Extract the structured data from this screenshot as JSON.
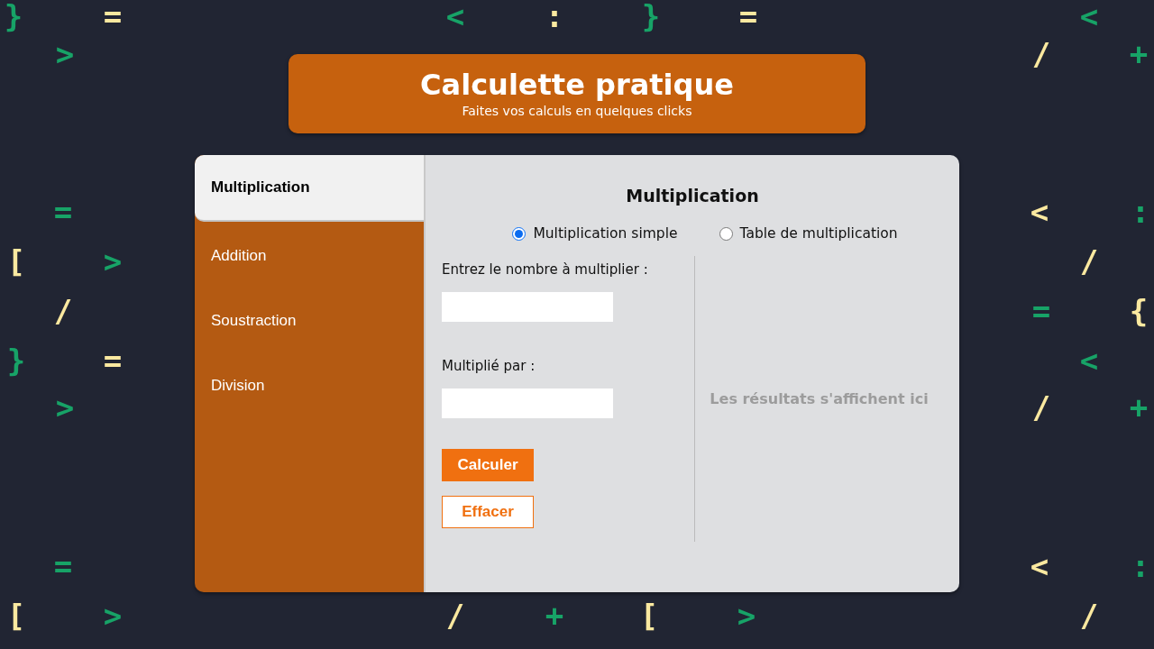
{
  "background_symbols": [
    [
      {
        "char": "}",
        "color": "#17a367"
      },
      {
        "char": "=",
        "color": "#fbe9a0"
      },
      {
        "char": "<",
        "color": "#17a367"
      },
      {
        "char": ":",
        "color": "#fbe9a0"
      },
      {
        "char": "}",
        "color": "#17a367"
      },
      {
        "char": "=",
        "color": "#fbe9a0"
      },
      {
        "char": "<",
        "color": "#17a367"
      }
    ],
    [
      {
        "char": ">",
        "color": "#17a367"
      },
      {
        "char": "/",
        "color": "#fbe9a0"
      },
      {
        "char": "+",
        "color": "#17a367"
      }
    ],
    [
      {
        "char": "=",
        "color": "#17a367"
      },
      {
        "char": "<",
        "color": "#fbe9a0"
      },
      {
        "char": ":",
        "color": "#17a367"
      }
    ],
    [
      {
        "char": "[",
        "color": "#fbe9a0"
      },
      {
        "char": ">",
        "color": "#17a367"
      },
      {
        "char": "/",
        "color": "#fbe9a0"
      }
    ],
    [
      {
        "char": "/",
        "color": "#fbe9a0"
      },
      {
        "char": "=",
        "color": "#17a367"
      },
      {
        "char": "{",
        "color": "#fbe9a0"
      }
    ],
    [
      {
        "char": "}",
        "color": "#17a367"
      },
      {
        "char": "=",
        "color": "#fbe9a0"
      },
      {
        "char": "<",
        "color": "#17a367"
      }
    ],
    [
      {
        "char": ">",
        "color": "#17a367"
      },
      {
        "char": "/",
        "color": "#fbe9a0"
      },
      {
        "char": "+",
        "color": "#17a367"
      }
    ],
    [
      {
        "char": "=",
        "color": "#17a367"
      },
      {
        "char": "<",
        "color": "#fbe9a0"
      },
      {
        "char": ":",
        "color": "#17a367"
      }
    ],
    [
      {
        "char": "[",
        "color": "#fbe9a0"
      },
      {
        "char": ">",
        "color": "#17a367"
      },
      {
        "char": "/",
        "color": "#fbe9a0"
      },
      {
        "char": "+",
        "color": "#17a367"
      },
      {
        "char": "[",
        "color": "#fbe9a0"
      },
      {
        "char": ">",
        "color": "#17a367"
      },
      {
        "char": "/",
        "color": "#fbe9a0"
      }
    ]
  ],
  "header": {
    "title": "Calculette pratique",
    "subtitle": "Faites vos calculs en quelques clicks"
  },
  "tabs": [
    {
      "label": "Multiplication",
      "selected": true
    },
    {
      "label": "Addition",
      "selected": false
    },
    {
      "label": "Soustraction",
      "selected": false
    },
    {
      "label": "Division",
      "selected": false
    }
  ],
  "panel": {
    "title": "Multiplication",
    "modes": [
      {
        "label": "Multiplication simple",
        "selected": true
      },
      {
        "label": "Table de multiplication",
        "selected": false
      }
    ],
    "fields": [
      {
        "label": "Entrez le nombre à multiplier :"
      },
      {
        "label": "Multiplié par :"
      }
    ],
    "buttons": [
      {
        "label": "Calculer",
        "kind": "primary"
      },
      {
        "label": "Effacer",
        "kind": "secondary"
      }
    ],
    "result_placeholder": "Les résultats s'affichent ici"
  }
}
